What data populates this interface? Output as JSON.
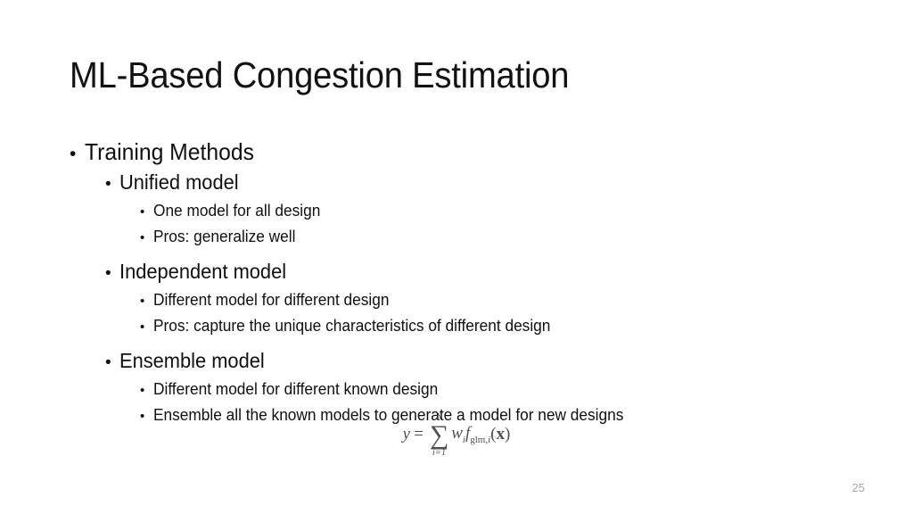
{
  "slide": {
    "title": "ML-Based Congestion Estimation",
    "page_number": "25",
    "text_color": "#101010",
    "background_color": "#ffffff",
    "page_number_color": "#a6a6a6"
  },
  "bullets": [
    {
      "level": 1,
      "marker": "•",
      "text": "Training Methods"
    },
    {
      "level": 2,
      "marker": "•",
      "text": "Unified model"
    },
    {
      "level": 3,
      "marker": "•",
      "text": "One model for all design"
    },
    {
      "level": 3,
      "marker": "•",
      "text": "Pros: generalize well"
    },
    {
      "level": 2,
      "marker": "•",
      "text": "Independent model"
    },
    {
      "level": 3,
      "marker": "•",
      "text": "Different model for different design"
    },
    {
      "level": 3,
      "marker": "•",
      "text": "Pros: capture the unique characteristics of different design"
    },
    {
      "level": 2,
      "marker": "•",
      "text": "Ensemble model"
    },
    {
      "level": 3,
      "marker": "•",
      "text": "Different model for different known design"
    },
    {
      "level": 3,
      "marker": "•",
      "text": "Ensemble all the known models to generate a model for new designs"
    }
  ],
  "equation": {
    "latex": "y = \\sum_{i=1}^{N} w_i f_{\\mathrm{glm},i}(\\mathbf{x})",
    "lhs": "y",
    "operator": "=",
    "sum_upper": "N",
    "sum_symbol": "∑",
    "sum_lower": "i=1",
    "weight_var": "w",
    "weight_sub": "i",
    "function_var": "f",
    "function_sub_roman": "glm,",
    "function_sub_italic": "i",
    "open_paren": "(",
    "argument": "x",
    "close_paren": ")"
  }
}
